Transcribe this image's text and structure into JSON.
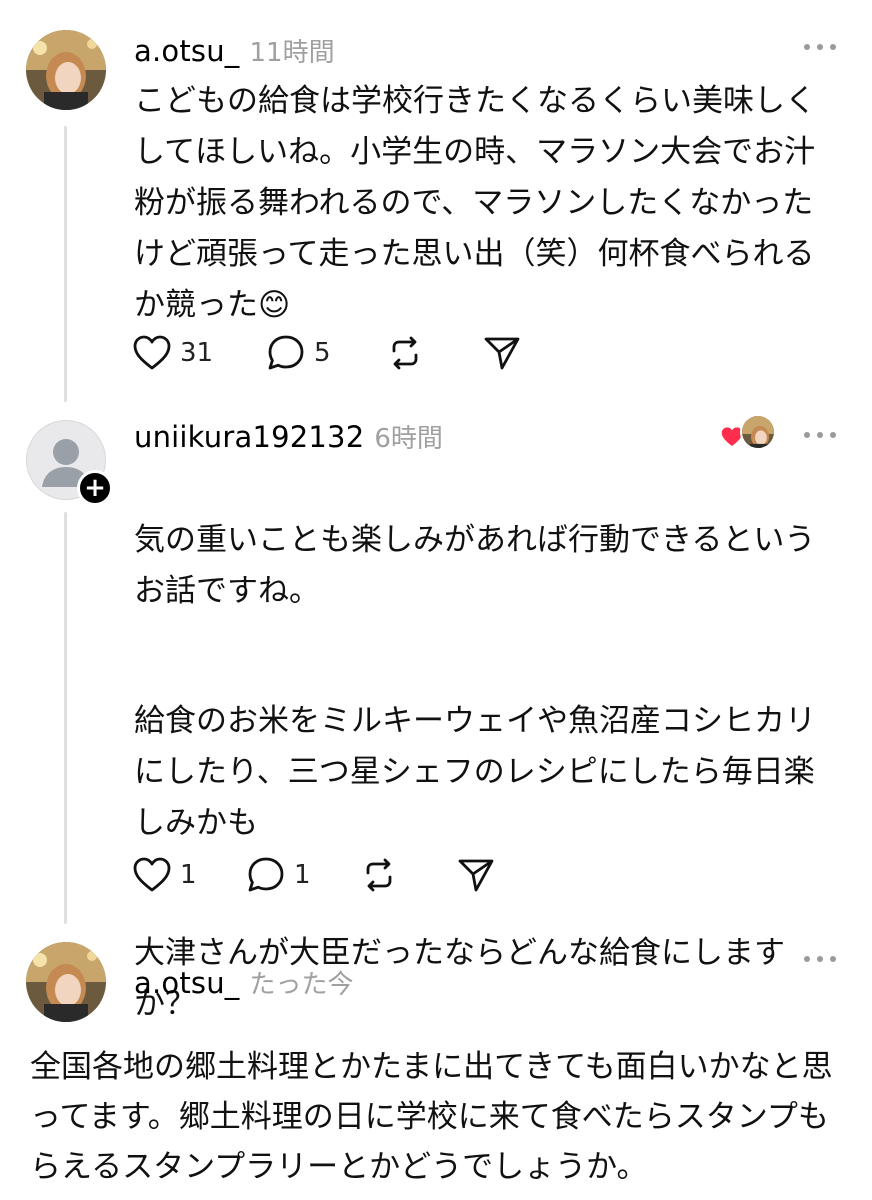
{
  "posts": [
    {
      "username": "a.otsu_",
      "time": "11時間",
      "text": "こどもの給食は学校行きたくなるくらい美味しくしてほしいね。小学生の時、マラソン大会でお汁粉が振る舞われるので、マラソンしたくなかったけど頑張って走った思い出（笑）何杯食べられるか競った😊",
      "likes": "31",
      "replies": "5"
    },
    {
      "username": "uniikura192132",
      "time": "6時間",
      "paragraphs": [
        "気の重いことも楽しみがあれば行動できるというお話ですね。",
        "給食のお米をミルキーウェイや魚沼産コシヒカリにしたり、三つ星シェフのレシピにしたら毎日楽しみかも",
        "大津さんが大臣だったならどんな給食にしますか？"
      ],
      "likes": "1",
      "replies": "1"
    },
    {
      "username": "a.otsu_",
      "time": "たった今",
      "text": "全国各地の郷土料理とかたまに出てきても面白いかなと思ってます。郷土料理の日に学校に来て食べたらスタンプもらえるスタンプラリーとかどうでしょうか。"
    }
  ],
  "icons": {
    "like": "heart-icon",
    "reply": "comment-icon",
    "repost": "repost-icon",
    "share": "send-icon",
    "more": "more-icon",
    "follow": "plus-icon"
  },
  "colors": {
    "liked_heart": "#ff2d4d",
    "timestamp": "#a0a0a0",
    "thread_line": "#e0e0e0"
  }
}
